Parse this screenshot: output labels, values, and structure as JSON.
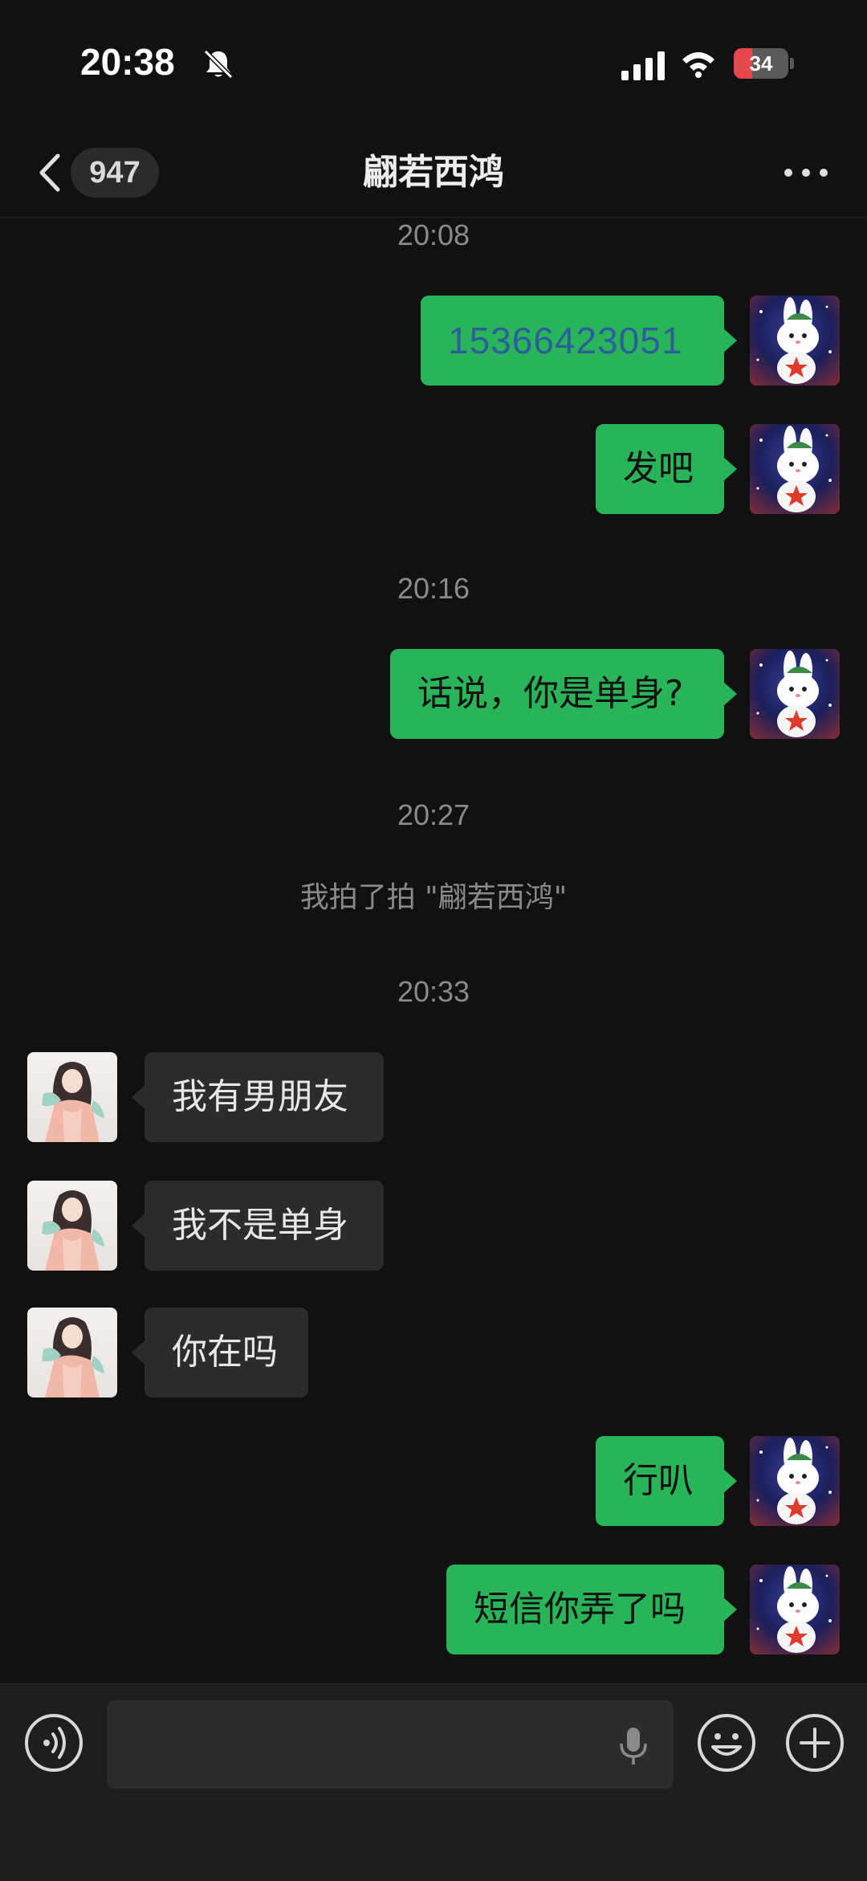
{
  "status_bar": {
    "time": "20:38",
    "battery_level": "34"
  },
  "header": {
    "unread_count": "947",
    "title": "翩若西鸿"
  },
  "messages": {
    "t1": "20:08",
    "m1": "15366423051",
    "m2": "发吧",
    "t2": "20:16",
    "m3": "话说，你是单身?",
    "t3": "20:27",
    "system_pat": "我拍了拍 \"翩若西鸿\"",
    "t4": "20:33",
    "m4": "我有男朋友",
    "m5": "我不是单身",
    "m6": "你在吗",
    "m7": "行叭",
    "m8": "短信你弄了吗"
  },
  "input_bar": {
    "icons": [
      "voice-icon",
      "microphone-icon",
      "emoji-icon",
      "plus-icon"
    ]
  },
  "colors": {
    "background": "#111111",
    "outgoing_bubble": "#29b459",
    "incoming_bubble": "#2c2c2c",
    "link": "#2d5e9c"
  }
}
